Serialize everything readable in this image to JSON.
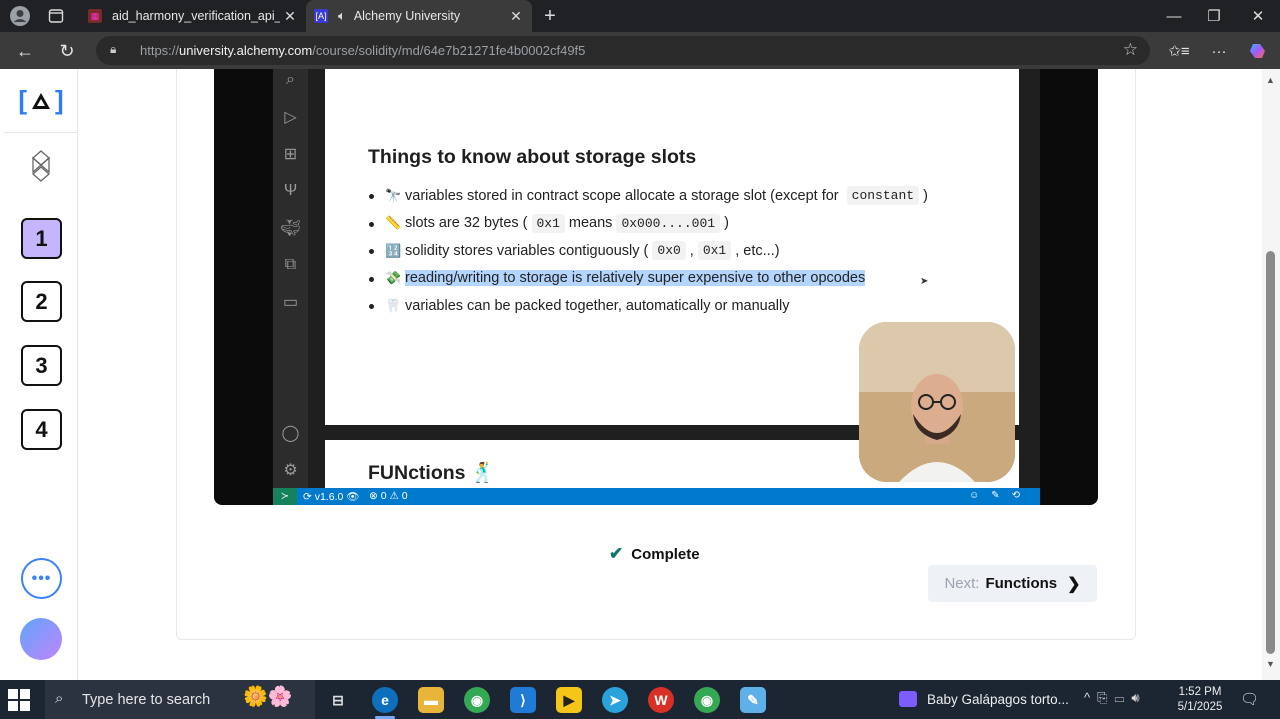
{
  "browser": {
    "tabs": [
      {
        "title": "aid_harmony_verification_api_field",
        "active": false
      },
      {
        "title": "Alchemy University",
        "active": true,
        "favicon": "[A]"
      }
    ],
    "new_tab_label": "+",
    "url_prefix": "https://",
    "url_domain": "university.alchemy.com",
    "url_path": "/course/solidity/md/64e7b21271fe4b0002cf49f5"
  },
  "sidebar": {
    "logo": "[A]",
    "steps": [
      "1",
      "2",
      "3",
      "4"
    ],
    "active_step": "1",
    "more_label": "•••"
  },
  "video": {
    "slide_title": "Things to know about storage slots",
    "bullets": [
      {
        "emoji": "🔭",
        "parts": [
          {
            "t": "variables stored in contract scope allocate a storage slot (except for "
          },
          {
            "code": "constant"
          },
          {
            "t": ")"
          }
        ]
      },
      {
        "emoji": "📏",
        "parts": [
          {
            "t": "slots are 32 bytes ("
          },
          {
            "code": "0x1"
          },
          {
            "t": "means"
          },
          {
            "code": "0x000....001"
          },
          {
            "t": ")"
          }
        ]
      },
      {
        "emoji": "🔢",
        "parts": [
          {
            "t": "solidity stores variables contiguously ("
          },
          {
            "code": "0x0"
          },
          {
            "t": ","
          },
          {
            "code": "0x1"
          },
          {
            "t": ", etc...)"
          }
        ]
      },
      {
        "emoji": "💸",
        "parts": [
          {
            "hl": "reading/writing to storage is relatively super expensive to other opcodes"
          }
        ]
      },
      {
        "emoji": "🦷",
        "parts": [
          {
            "t": "variables can be packed together, automatically or manually"
          }
        ]
      }
    ],
    "next_slide_title": "FUNctions 🕺",
    "status_version": "v1.6.0",
    "status_problems": "⊗ 0 ⚠ 0"
  },
  "lesson": {
    "complete_label": "Complete",
    "next_prefix": "Next:",
    "next_label": "Functions"
  },
  "taskbar": {
    "search_placeholder": "Type here to search",
    "media_title": "Baby Galápagos torto...",
    "time": "1:52 PM",
    "date": "5/1/2025"
  },
  "colors": {
    "accent_step": "#c4b5fd",
    "statusbar": "#007acc",
    "highlight": "#b4d5fe"
  }
}
